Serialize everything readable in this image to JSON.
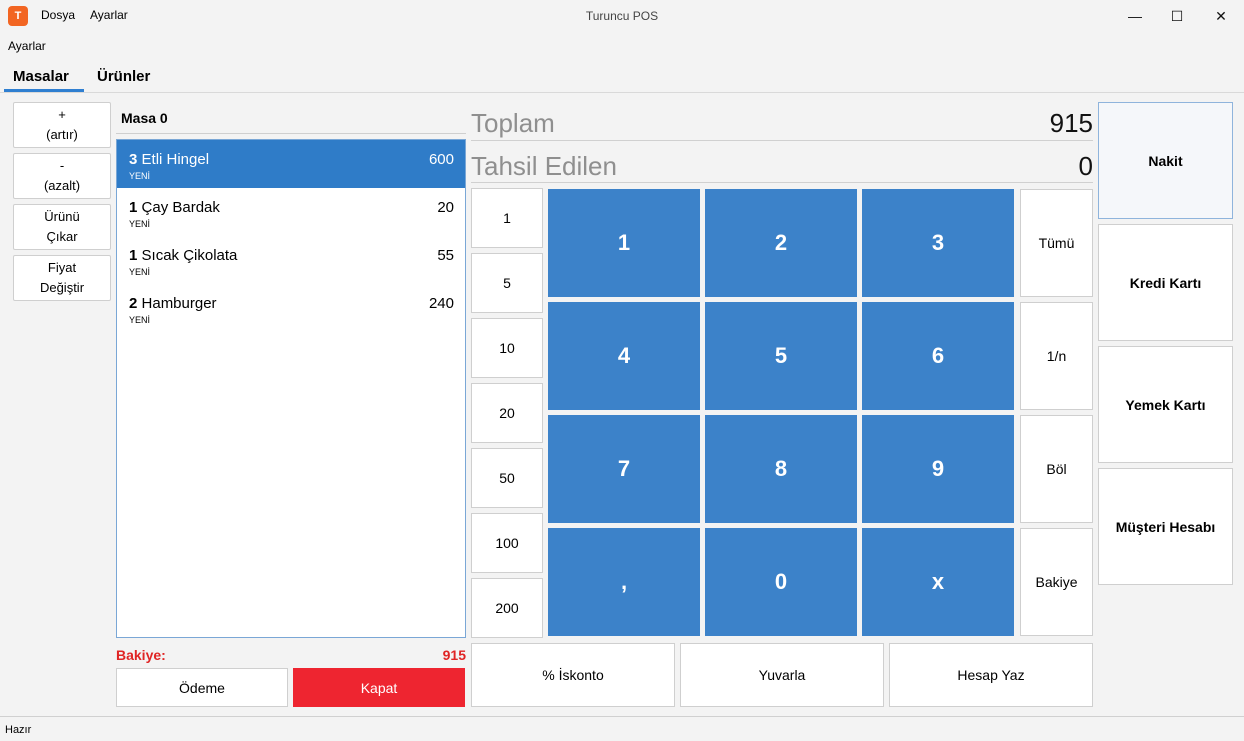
{
  "window": {
    "title": "Turuncu POS",
    "app_icon_text": "T",
    "minimize": "—",
    "maximize": "☐",
    "close": "✕"
  },
  "menu": [
    "Dosya",
    "Ayarlar"
  ],
  "settings_label": "Ayarlar",
  "tabs": [
    "Masalar",
    "Ürünler"
  ],
  "side_buttons": [
    {
      "line1": "+",
      "line2": "(artır)"
    },
    {
      "line1": "-",
      "line2": "(azalt)"
    },
    {
      "line1": "Ürünü",
      "line2": "Çıkar"
    },
    {
      "line1": "Fiyat",
      "line2": "Değiştir"
    }
  ],
  "table_name": "Masa 0",
  "orders": [
    {
      "qty": "3",
      "name": "Etli Hingel",
      "status": "YENİ",
      "price": "600"
    },
    {
      "qty": "1",
      "name": "Çay Bardak",
      "status": "YENİ",
      "price": "20"
    },
    {
      "qty": "1",
      "name": "Sıcak Çikolata",
      "status": "YENİ",
      "price": "55"
    },
    {
      "qty": "2",
      "name": "Hamburger",
      "status": "YENİ",
      "price": "240"
    }
  ],
  "balance": {
    "label": "Bakiye:",
    "value": "915"
  },
  "odeme_label": "Ödeme",
  "kapat_label": "Kapat",
  "totals": {
    "toplam_label": "Toplam",
    "toplam_value": "915",
    "tahsil_label": "Tahsil Edilen",
    "tahsil_value": "0"
  },
  "quick_amounts": [
    "1",
    "5",
    "10",
    "20",
    "50",
    "100",
    "200"
  ],
  "keypad": [
    "1",
    "2",
    "3",
    "4",
    "5",
    "6",
    "7",
    "8",
    "9",
    ",",
    "0",
    "x"
  ],
  "functions": [
    "Tümü",
    "1/n",
    "Böl",
    "Bakiye"
  ],
  "bottom_buttons": [
    "% İskonto",
    "Yuvarla",
    "Hesap Yaz"
  ],
  "payments": [
    "Nakit",
    "Kredi Kartı",
    "Yemek Kartı",
    "Müşteri Hesabı"
  ],
  "status_text": "Hazır",
  "colors": {
    "accent": "#3c82c9",
    "danger": "#ee2530",
    "selected_row": "#2f7cc8",
    "brand": "#f26522"
  }
}
